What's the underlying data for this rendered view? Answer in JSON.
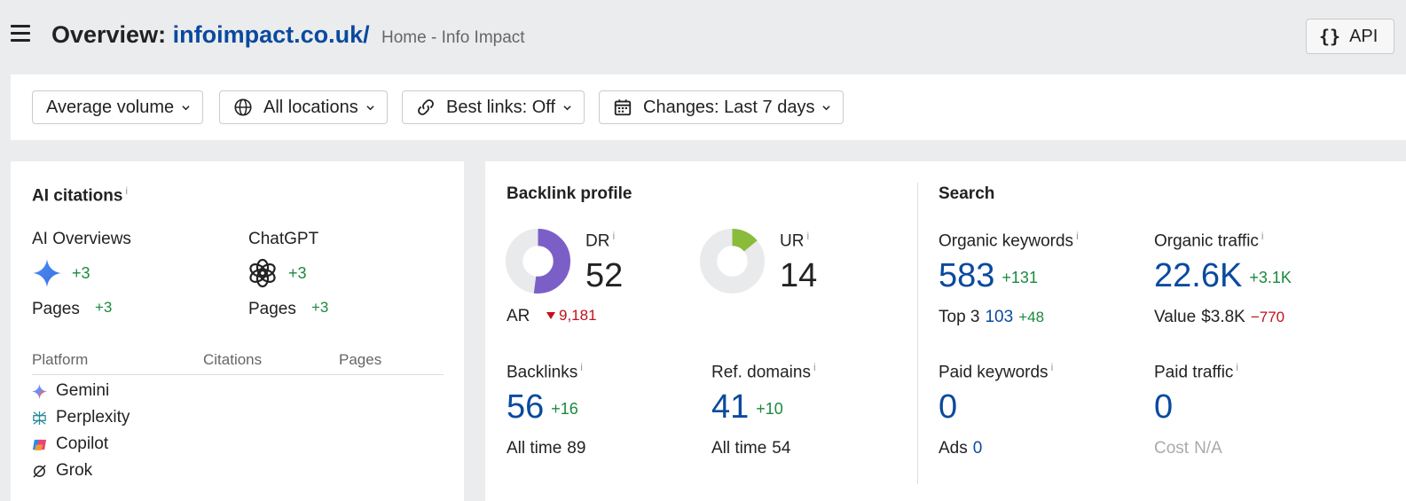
{
  "header": {
    "title_prefix": "Overview:",
    "domain": "infoimpact.co.uk/",
    "page_title": "Home - Info Impact",
    "api_label": "API"
  },
  "filters": [
    {
      "label": "Average volume",
      "icon": "none"
    },
    {
      "label": "All locations",
      "icon": "globe-icon"
    },
    {
      "label": "Best links: Off",
      "icon": "link-icon"
    },
    {
      "label": "Changes: Last 7 days",
      "icon": "calendar-icon"
    }
  ],
  "ai_citations": {
    "title": "AI citations",
    "info": "i",
    "ai_overviews": {
      "label": "AI Overviews",
      "delta": "+3",
      "pages_label": "Pages",
      "pages_delta": "+3"
    },
    "chatgpt": {
      "label": "ChatGPT",
      "delta": "+3",
      "pages_label": "Pages",
      "pages_delta": "+3"
    },
    "columns": [
      "Platform",
      "Citations",
      "Pages"
    ],
    "platforms": [
      "Gemini",
      "Perplexity",
      "Copilot",
      "Grok"
    ]
  },
  "backlink_profile": {
    "title": "Backlink profile",
    "dr": {
      "label": "DR",
      "value": "52",
      "fraction": 0.52,
      "color": "#7b5fc7"
    },
    "ar": {
      "label": "AR",
      "value": "9,181"
    },
    "ur": {
      "label": "UR",
      "value": "14",
      "fraction": 0.14,
      "color": "#8bbb3a"
    },
    "backlinks": {
      "label": "Backlinks",
      "value": "56",
      "delta": "+16",
      "all_time_label": "All time",
      "all_time": "89"
    },
    "ref_domains": {
      "label": "Ref. domains",
      "value": "41",
      "delta": "+10",
      "all_time_label": "All time",
      "all_time": "54"
    }
  },
  "search": {
    "title": "Search",
    "organic_keywords": {
      "label": "Organic keywords",
      "value": "583",
      "delta": "+131",
      "top3_label": "Top 3",
      "top3": "103",
      "top3_delta": "+48"
    },
    "organic_traffic": {
      "label": "Organic traffic",
      "value": "22.6K",
      "delta": "+3.1K",
      "value_label": "Value",
      "traffic_value": "$3.8K",
      "value_delta": "−770"
    },
    "paid_keywords": {
      "label": "Paid keywords",
      "value": "0",
      "ads_label": "Ads",
      "ads": "0"
    },
    "paid_traffic": {
      "label": "Paid traffic",
      "value": "0",
      "cost_label": "Cost",
      "cost": "N/A"
    }
  },
  "colors": {
    "accent_blue": "#0a4a9e",
    "positive": "#1a8a3e",
    "negative": "#c0121b"
  }
}
